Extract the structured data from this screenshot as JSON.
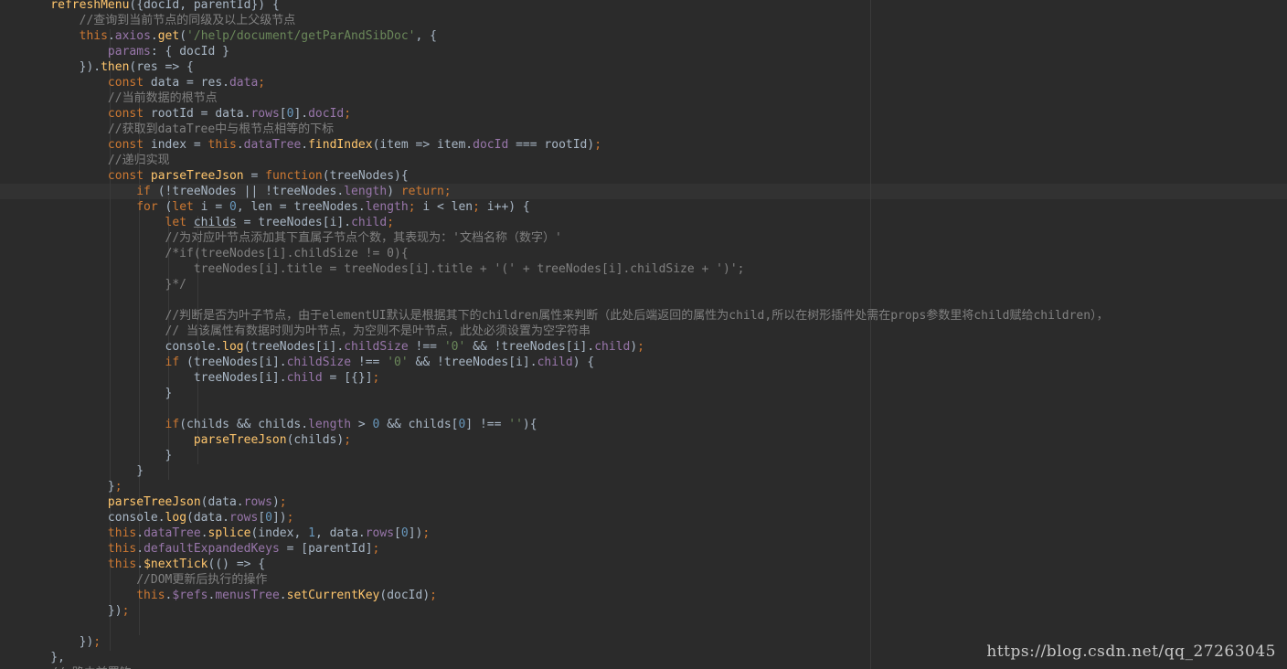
{
  "editor": {
    "watermark": "https://blog.csdn.net/qq_27263045",
    "colors": {
      "background": "#2b2b2b",
      "keyword": "#cc7832",
      "function": "#ffc66d",
      "string": "#6a8759",
      "comment": "#808080",
      "property": "#9876aa",
      "number": "#6897bb",
      "text": "#a9b7c6"
    },
    "lines": [
      [
        {
          "t": "    refreshMenu",
          "c": "fn"
        },
        {
          "t": "({docId, parentId}) {",
          "c": ""
        }
      ],
      [
        {
          "t": "        //查询到当前节点的同级及以上父级节点",
          "c": "cm"
        }
      ],
      [
        {
          "t": "        ",
          "c": ""
        },
        {
          "t": "this",
          "c": "kw"
        },
        {
          "t": ".",
          "c": ""
        },
        {
          "t": "axios",
          "c": "prop"
        },
        {
          "t": ".",
          "c": ""
        },
        {
          "t": "get",
          "c": "fn"
        },
        {
          "t": "(",
          "c": ""
        },
        {
          "t": "'/help/document/getParAndSibDoc'",
          "c": "str"
        },
        {
          "t": ", {",
          "c": ""
        }
      ],
      [
        {
          "t": "            ",
          "c": ""
        },
        {
          "t": "params",
          "c": "prop"
        },
        {
          "t": ": { docId }",
          "c": ""
        }
      ],
      [
        {
          "t": "        }).",
          "c": ""
        },
        {
          "t": "then",
          "c": "fn"
        },
        {
          "t": "(res => {",
          "c": ""
        }
      ],
      [
        {
          "t": "            ",
          "c": ""
        },
        {
          "t": "const",
          "c": "kw"
        },
        {
          "t": " data = res.",
          "c": ""
        },
        {
          "t": "data",
          "c": "prop"
        },
        {
          "t": ";",
          "c": "kw"
        }
      ],
      [
        {
          "t": "            //当前数据的根节点",
          "c": "cm"
        }
      ],
      [
        {
          "t": "            ",
          "c": ""
        },
        {
          "t": "const",
          "c": "kw"
        },
        {
          "t": " rootId = data.",
          "c": ""
        },
        {
          "t": "rows",
          "c": "prop"
        },
        {
          "t": "[",
          "c": ""
        },
        {
          "t": "0",
          "c": "num"
        },
        {
          "t": "].",
          "c": ""
        },
        {
          "t": "docId",
          "c": "prop"
        },
        {
          "t": ";",
          "c": "kw"
        }
      ],
      [
        {
          "t": "            //获取到dataTree中与根节点相等的下标",
          "c": "cm"
        }
      ],
      [
        {
          "t": "            ",
          "c": ""
        },
        {
          "t": "const",
          "c": "kw"
        },
        {
          "t": " index = ",
          "c": ""
        },
        {
          "t": "this",
          "c": "kw"
        },
        {
          "t": ".",
          "c": ""
        },
        {
          "t": "dataTree",
          "c": "prop"
        },
        {
          "t": ".",
          "c": ""
        },
        {
          "t": "findIndex",
          "c": "fn"
        },
        {
          "t": "(item => item.",
          "c": ""
        },
        {
          "t": "docId",
          "c": "prop"
        },
        {
          "t": " === rootId)",
          "c": ""
        },
        {
          "t": ";",
          "c": "kw"
        }
      ],
      [
        {
          "t": "            //递归实现",
          "c": "cm"
        }
      ],
      [
        {
          "t": "            ",
          "c": ""
        },
        {
          "t": "const",
          "c": "kw"
        },
        {
          "t": " ",
          "c": ""
        },
        {
          "t": "parseTreeJson",
          "c": "fn"
        },
        {
          "t": " = ",
          "c": ""
        },
        {
          "t": "function",
          "c": "kw"
        },
        {
          "t": "(treeNodes){",
          "c": ""
        }
      ],
      [
        {
          "t": "                ",
          "c": ""
        },
        {
          "t": "if",
          "c": "kw"
        },
        {
          "t": " (!treeNodes || !treeNodes.",
          "c": ""
        },
        {
          "t": "length",
          "c": "prop"
        },
        {
          "t": ") ",
          "c": ""
        },
        {
          "t": "return;",
          "c": "kw"
        }
      ],
      [
        {
          "t": "                ",
          "c": ""
        },
        {
          "t": "for",
          "c": "kw"
        },
        {
          "t": " (",
          "c": ""
        },
        {
          "t": "let",
          "c": "kw"
        },
        {
          "t": " i = ",
          "c": ""
        },
        {
          "t": "0",
          "c": "num"
        },
        {
          "t": ", len = treeNodes.",
          "c": ""
        },
        {
          "t": "length",
          "c": "prop"
        },
        {
          "t": "; ",
          "c": "kw"
        },
        {
          "t": "i < len",
          "c": ""
        },
        {
          "t": "; ",
          "c": "kw"
        },
        {
          "t": "i++) {",
          "c": ""
        }
      ],
      [
        {
          "t": "                    ",
          "c": ""
        },
        {
          "t": "let",
          "c": "kw"
        },
        {
          "t": " ",
          "c": ""
        },
        {
          "t": "childs",
          "c": "ul"
        },
        {
          "t": " = treeNodes[i].",
          "c": ""
        },
        {
          "t": "child",
          "c": "prop"
        },
        {
          "t": ";",
          "c": "kw"
        }
      ],
      [
        {
          "t": "                    //为对应叶节点添加其下直属子节点个数，其表现为：'文档名称（数字）'",
          "c": "cm"
        }
      ],
      [
        {
          "t": "                    /*if(treeNodes[i].childSize != 0){",
          "c": "cm"
        }
      ],
      [
        {
          "t": "                        treeNodes[i].title = treeNodes[i].title + '(' + treeNodes[i].childSize + ')';",
          "c": "cm"
        }
      ],
      [
        {
          "t": "                    }*/",
          "c": "cm"
        }
      ],
      [
        {
          "t": "",
          "c": ""
        }
      ],
      [
        {
          "t": "                    //判断是否为叶子节点，由于elementUI默认是根据其下的children属性来判断（此处后端返回的属性为child,所以在树形插件处需在props参数里将child赋给children），",
          "c": "cm"
        }
      ],
      [
        {
          "t": "                    // 当该属性有数据时则为叶节点，为空则不是叶节点，此处必须设置为空字符串",
          "c": "cm"
        }
      ],
      [
        {
          "t": "                    console.",
          "c": ""
        },
        {
          "t": "log",
          "c": "fn"
        },
        {
          "t": "(treeNodes[i].",
          "c": ""
        },
        {
          "t": "childSize",
          "c": "prop"
        },
        {
          "t": " !== ",
          "c": ""
        },
        {
          "t": "'0'",
          "c": "str"
        },
        {
          "t": " && !treeNodes[i].",
          "c": ""
        },
        {
          "t": "child",
          "c": "prop"
        },
        {
          "t": ")",
          "c": ""
        },
        {
          "t": ";",
          "c": "kw"
        }
      ],
      [
        {
          "t": "                    ",
          "c": ""
        },
        {
          "t": "if",
          "c": "kw"
        },
        {
          "t": " (treeNodes[i].",
          "c": ""
        },
        {
          "t": "childSize",
          "c": "prop"
        },
        {
          "t": " !== ",
          "c": ""
        },
        {
          "t": "'0'",
          "c": "str"
        },
        {
          "t": " && !treeNodes[i].",
          "c": ""
        },
        {
          "t": "child",
          "c": "prop"
        },
        {
          "t": ") {",
          "c": ""
        }
      ],
      [
        {
          "t": "                        treeNodes[i].",
          "c": ""
        },
        {
          "t": "child",
          "c": "prop"
        },
        {
          "t": " = [{}]",
          "c": ""
        },
        {
          "t": ";",
          "c": "kw"
        }
      ],
      [
        {
          "t": "                    }",
          "c": ""
        }
      ],
      [
        {
          "t": "",
          "c": ""
        }
      ],
      [
        {
          "t": "                    ",
          "c": ""
        },
        {
          "t": "if",
          "c": "kw"
        },
        {
          "t": "(childs && childs.",
          "c": ""
        },
        {
          "t": "length",
          "c": "prop"
        },
        {
          "t": " > ",
          "c": ""
        },
        {
          "t": "0",
          "c": "num"
        },
        {
          "t": " && childs[",
          "c": ""
        },
        {
          "t": "0",
          "c": "num"
        },
        {
          "t": "] !== ",
          "c": ""
        },
        {
          "t": "''",
          "c": "str"
        },
        {
          "t": "){",
          "c": ""
        }
      ],
      [
        {
          "t": "                        ",
          "c": ""
        },
        {
          "t": "parseTreeJson",
          "c": "fn"
        },
        {
          "t": "(childs)",
          "c": ""
        },
        {
          "t": ";",
          "c": "kw"
        }
      ],
      [
        {
          "t": "                    }",
          "c": ""
        }
      ],
      [
        {
          "t": "                }",
          "c": ""
        }
      ],
      [
        {
          "t": "            }",
          "c": ""
        },
        {
          "t": ";",
          "c": "kw"
        }
      ],
      [
        {
          "t": "            ",
          "c": ""
        },
        {
          "t": "parseTreeJson",
          "c": "fn"
        },
        {
          "t": "(data.",
          "c": ""
        },
        {
          "t": "rows",
          "c": "prop"
        },
        {
          "t": ")",
          "c": ""
        },
        {
          "t": ";",
          "c": "kw"
        }
      ],
      [
        {
          "t": "            console.",
          "c": ""
        },
        {
          "t": "log",
          "c": "fn"
        },
        {
          "t": "(data.",
          "c": ""
        },
        {
          "t": "rows",
          "c": "prop"
        },
        {
          "t": "[",
          "c": ""
        },
        {
          "t": "0",
          "c": "num"
        },
        {
          "t": "])",
          "c": ""
        },
        {
          "t": ";",
          "c": "kw"
        }
      ],
      [
        {
          "t": "            ",
          "c": ""
        },
        {
          "t": "this",
          "c": "kw"
        },
        {
          "t": ".",
          "c": ""
        },
        {
          "t": "dataTree",
          "c": "prop"
        },
        {
          "t": ".",
          "c": ""
        },
        {
          "t": "splice",
          "c": "fn"
        },
        {
          "t": "(index, ",
          "c": ""
        },
        {
          "t": "1",
          "c": "num"
        },
        {
          "t": ", data.",
          "c": ""
        },
        {
          "t": "rows",
          "c": "prop"
        },
        {
          "t": "[",
          "c": ""
        },
        {
          "t": "0",
          "c": "num"
        },
        {
          "t": "])",
          "c": ""
        },
        {
          "t": ";",
          "c": "kw"
        }
      ],
      [
        {
          "t": "            ",
          "c": ""
        },
        {
          "t": "this",
          "c": "kw"
        },
        {
          "t": ".",
          "c": ""
        },
        {
          "t": "defaultExpandedKeys",
          "c": "prop"
        },
        {
          "t": " = [parentId]",
          "c": ""
        },
        {
          "t": ";",
          "c": "kw"
        }
      ],
      [
        {
          "t": "            ",
          "c": ""
        },
        {
          "t": "this",
          "c": "kw"
        },
        {
          "t": ".",
          "c": ""
        },
        {
          "t": "$nextTick",
          "c": "fn"
        },
        {
          "t": "(() => {",
          "c": ""
        }
      ],
      [
        {
          "t": "                //DOM更新后执行的操作",
          "c": "cm"
        }
      ],
      [
        {
          "t": "                ",
          "c": ""
        },
        {
          "t": "this",
          "c": "kw"
        },
        {
          "t": ".",
          "c": ""
        },
        {
          "t": "$refs",
          "c": "prop"
        },
        {
          "t": ".",
          "c": ""
        },
        {
          "t": "menusTree",
          "c": "prop"
        },
        {
          "t": ".",
          "c": ""
        },
        {
          "t": "setCurrentKey",
          "c": "fn"
        },
        {
          "t": "(docId)",
          "c": ""
        },
        {
          "t": ";",
          "c": "kw"
        }
      ],
      [
        {
          "t": "            })",
          "c": ""
        },
        {
          "t": ";",
          "c": "kw"
        }
      ],
      [
        {
          "t": "",
          "c": ""
        }
      ],
      [
        {
          "t": "        })",
          "c": ""
        },
        {
          "t": ";",
          "c": "kw"
        }
      ],
      [
        {
          "t": "    },",
          "c": ""
        }
      ],
      [
        {
          "t": "    // 路由前置钩",
          "c": "cm"
        }
      ]
    ]
  }
}
